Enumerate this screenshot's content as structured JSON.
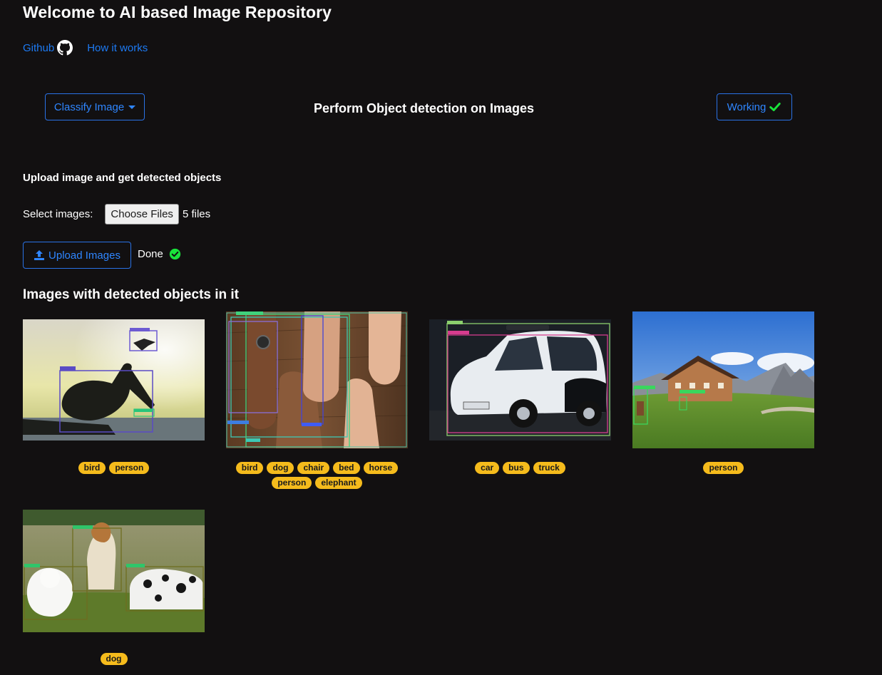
{
  "header": {
    "title": "Welcome to AI based Image Repository",
    "links": [
      {
        "label": "Github",
        "icon": "github-icon"
      },
      {
        "label": "How it works"
      }
    ]
  },
  "toolbar": {
    "classify_label": "Classify Image",
    "mode_title": "Perform Object detection on Images",
    "status_label": "Working",
    "status_color": "#19e33b"
  },
  "upload": {
    "heading": "Upload image and get detected objects",
    "select_label": "Select images:",
    "choose_button": "Choose Files",
    "file_count": "5 files",
    "upload_button": "Upload Images",
    "status": "Done"
  },
  "gallery": {
    "heading": "Images with detected objects in it",
    "images": [
      {
        "subject": "pelican silhouette at sunset",
        "tags": [
          "bird",
          "person"
        ]
      },
      {
        "subject": "hands on wooden table",
        "tags": [
          "bird",
          "dog",
          "chair",
          "bed",
          "horse",
          "person",
          "elephant"
        ]
      },
      {
        "subject": "white smart car",
        "tags": [
          "car",
          "bus",
          "truck"
        ]
      },
      {
        "subject": "mountain chalet with cows",
        "tags": [
          "person"
        ]
      },
      {
        "subject": "three dogs on grass",
        "tags": [
          "dog"
        ]
      }
    ]
  },
  "colors": {
    "background": "#121011",
    "accent": "#2f86ff",
    "tag": "#f5bb1c",
    "success": "#19e33b"
  }
}
